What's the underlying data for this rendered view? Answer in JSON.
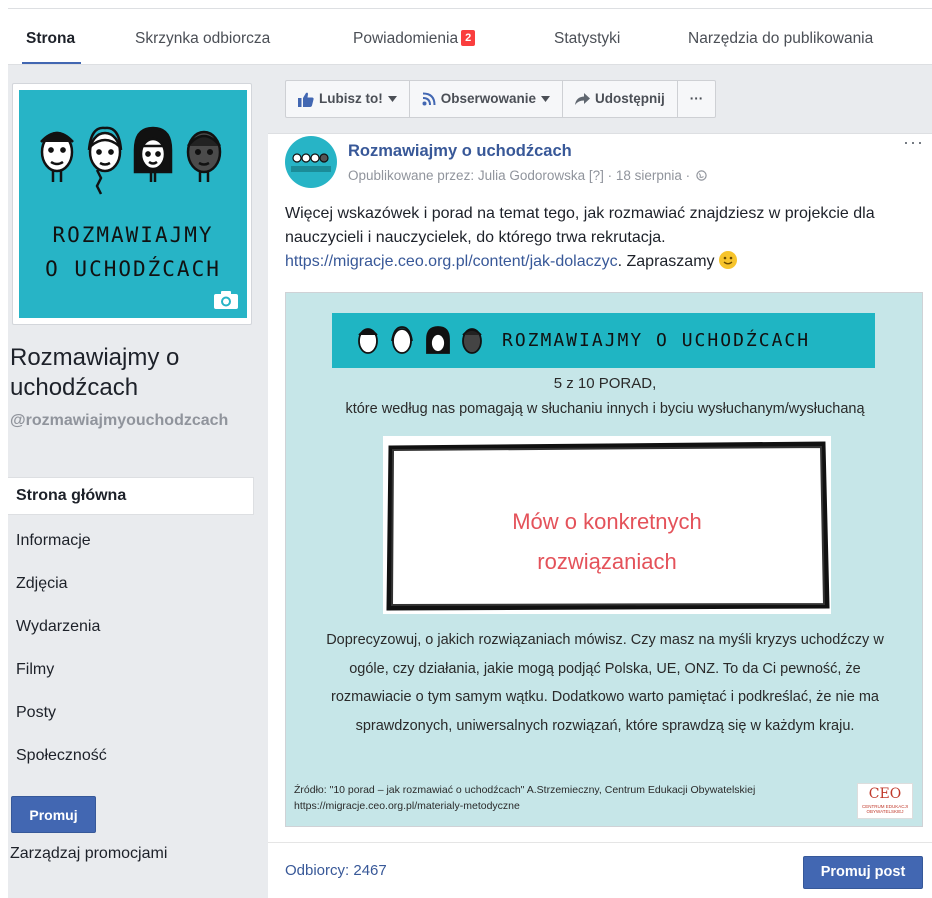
{
  "tabs": {
    "page": "Strona",
    "inbox": "Skrzynka odbiorcza",
    "notifications": "Powiadomienia",
    "notifications_count": "2",
    "insights": "Statystyki",
    "publishing_tools": "Narzędzia do publikowania"
  },
  "sidebar": {
    "cover_title_line1": "ROZMAWIAJMY",
    "cover_title_line2": "O UCHODŹCACH",
    "page_name": "Rozmawiajmy o uchodźcach",
    "page_handle": "@rozmawiajmyouchodzcach",
    "nav": {
      "home": "Strona główna",
      "about": "Informacje",
      "photos": "Zdjęcia",
      "events": "Wydarzenia",
      "videos": "Filmy",
      "posts": "Posty",
      "community": "Społeczność"
    },
    "promote_button": "Promuj",
    "manage_promotions": "Zarządzaj promocjami"
  },
  "actions": {
    "like": "Lubisz to!",
    "follow": "Obserwowanie",
    "share": "Udostępnij",
    "more": "···"
  },
  "post": {
    "author": "Rozmawiajmy o uchodźcach",
    "meta": "Opublikowane przez: Julia Godorowska [?] · 18 sierpnia ·",
    "more": "···",
    "text_before_link": "Więcej wskazówek i porad na temat tego, jak rozmawiać znajdziesz w projekcie dla nauczycieli i nauczycielek, do którego trwa rekrutacja.",
    "link": "https://migracje.ceo.org.pl/content/jak-dolaczyc",
    "text_after_link": ". Zapraszamy",
    "image": {
      "banner_title": "ROZMAWIAJMY O UCHODŹCACH",
      "tip_number": "5 z 10 PORAD,",
      "tip_subtitle": "które według nas pomagają w słuchaniu innych i byciu wysłuchanym/wysłuchaną",
      "card_line1": "Mów o konkretnych",
      "card_line2": "rozwiązaniach",
      "description": "Doprecyzowuj, o jakich rozwiązaniach mówisz. Czy masz na myśli kryzys uchodźczy w ogóle, czy działania, jakie mogą podjąć Polska, UE, ONZ. To da Ci pewność, że rozmawiacie o tym samym wątku. Dodatkowo warto pamiętać i podkreślać, że nie ma sprawdzonych, uniwersalnych rozwiązań, które sprawdzą się w każdym kraju.",
      "source_line1": "Źródło: \"10 porad – jak rozmawiać o uchodźcach\" A.Strzemieczny, Centrum Edukacji Obywatelskiej",
      "source_line2": "https://migracje.ceo.org.pl/materialy-metodyczne",
      "logo_text": "CEO",
      "logo_subtext": "CENTRUM EDUKACJI OBYWATELSKIEJ"
    },
    "reach": "Odbiorcy: 2467",
    "promote_post": "Promuj post"
  },
  "colors": {
    "brand_blue": "#4267b2",
    "link_blue": "#385898",
    "cover_teal": "#27b4c6",
    "badge_red": "#fa3e3e",
    "card_text_red": "#e4525a"
  },
  "icons": [
    "thumbs-up-icon",
    "rss-icon",
    "share-arrow-icon",
    "globe-icon",
    "camera-icon",
    "chevron-down-icon",
    "smiley-icon"
  ]
}
